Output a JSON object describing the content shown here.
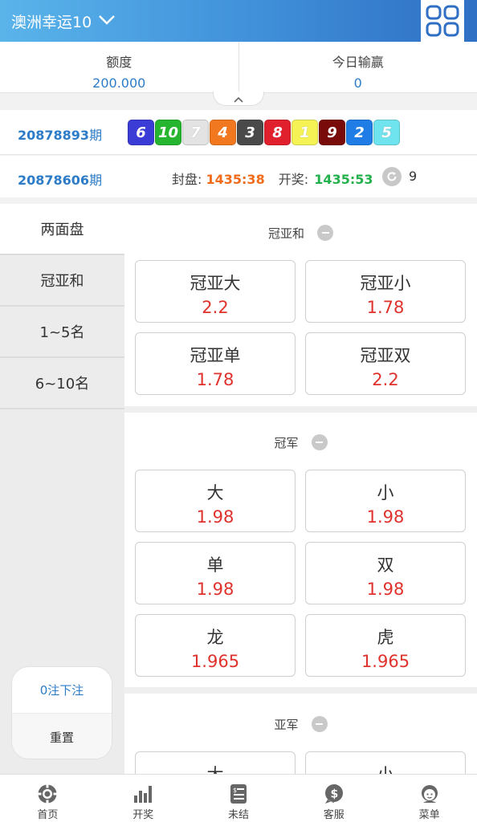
{
  "header": {
    "title": "澳洲幸运10"
  },
  "balance": {
    "credit_label": "额度",
    "credit_value": "200.000",
    "winloss_label": "今日输赢",
    "winloss_value": "0"
  },
  "last_draw": {
    "issue": "20878893",
    "suffix": "期",
    "balls": [
      {
        "n": "6",
        "color": "#3b3bd6"
      },
      {
        "n": "10",
        "color": "#26b52e"
      },
      {
        "n": "7",
        "color": "#e3e3e3"
      },
      {
        "n": "4",
        "color": "#f2781f"
      },
      {
        "n": "3",
        "color": "#4a4a4a"
      },
      {
        "n": "8",
        "color": "#e0202c"
      },
      {
        "n": "1",
        "color": "#f4f254"
      },
      {
        "n": "9",
        "color": "#7a0b0b"
      },
      {
        "n": "2",
        "color": "#1f7de5"
      },
      {
        "n": "5",
        "color": "#6fe3ee"
      }
    ]
  },
  "next_draw": {
    "issue": "20878606",
    "suffix": "期",
    "close_label": "封盘:",
    "close_time": "1435:38",
    "open_label": "开奖:",
    "open_time": "1435:53",
    "refresh_count": "9"
  },
  "leftnav": {
    "items": [
      "两面盘",
      "冠亚和",
      "1~5名",
      "6~10名"
    ],
    "bet_count": "0注下注",
    "reset": "重置"
  },
  "sections": [
    {
      "title": "冠亚和",
      "options": [
        {
          "name": "冠亚大",
          "odds": "2.2"
        },
        {
          "name": "冠亚小",
          "odds": "1.78"
        },
        {
          "name": "冠亚单",
          "odds": "1.78"
        },
        {
          "name": "冠亚双",
          "odds": "2.2"
        }
      ]
    },
    {
      "title": "冠军",
      "options": [
        {
          "name": "大",
          "odds": "1.98"
        },
        {
          "name": "小",
          "odds": "1.98"
        },
        {
          "name": "单",
          "odds": "1.98"
        },
        {
          "name": "双",
          "odds": "1.98"
        },
        {
          "name": "龙",
          "odds": "1.965"
        },
        {
          "name": "虎",
          "odds": "1.965"
        }
      ]
    },
    {
      "title": "亚军",
      "options": [
        {
          "name": "大",
          "odds": ""
        },
        {
          "name": "小",
          "odds": ""
        }
      ]
    }
  ],
  "tabbar": {
    "items": [
      {
        "label": "首页",
        "icon": "home-chip-icon"
      },
      {
        "label": "开奖",
        "icon": "bar-chart-icon"
      },
      {
        "label": "未结",
        "icon": "unsettled-list-icon"
      },
      {
        "label": "客服",
        "icon": "customer-service-icon"
      },
      {
        "label": "菜单",
        "icon": "user-menu-icon"
      }
    ]
  }
}
